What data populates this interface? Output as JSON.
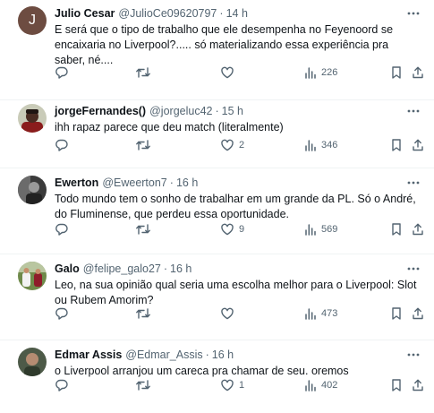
{
  "tweets": [
    {
      "name": "Julio Cesar",
      "handle": "@JulioCe09620797",
      "time": "14 h",
      "avatar_letter": "J",
      "text": "E será que o tipo de trabalho que ele desempenha no Feyenoord se encaixaria no Liverpool?..... só materializando essa experiência pra saber, né....",
      "likes": "",
      "views": "226"
    },
    {
      "name": "jorgeFernandes()",
      "handle": "@jorgeluc42",
      "time": "15 h",
      "text": "ihh rapaz parece que deu match (literalmente)",
      "likes": "2",
      "views": "346"
    },
    {
      "name": "Ewerton",
      "handle": "@Eweerton7",
      "time": "16 h",
      "text": "Todo mundo tem o sonho de trabalhar em um grande da PL. Só o André, do Fluminense, que perdeu essa oportunidade.",
      "likes": "9",
      "views": "569"
    },
    {
      "name": "Galo",
      "handle": "@felipe_galo27",
      "time": "16 h",
      "text": "Leo, na sua opinião qual seria uma escolha melhor para o Liverpool: Slot ou Rubem Amorim?",
      "likes": "",
      "views": "473"
    },
    {
      "name": "Edmar Assis",
      "handle": "@Edmar_Assis",
      "time": "16 h",
      "text": "o Liverpool arranjou um careca pra chamar de seu. oremos",
      "likes": "1",
      "views": "402"
    }
  ],
  "colors": {
    "text": "#0f1419",
    "secondary": "#536471",
    "border": "#eff3f4",
    "background": "#ffffff"
  },
  "icons": [
    "reply-icon",
    "retweet-icon",
    "like-icon",
    "views-icon",
    "bookmark-icon",
    "share-icon",
    "more-icon"
  ]
}
